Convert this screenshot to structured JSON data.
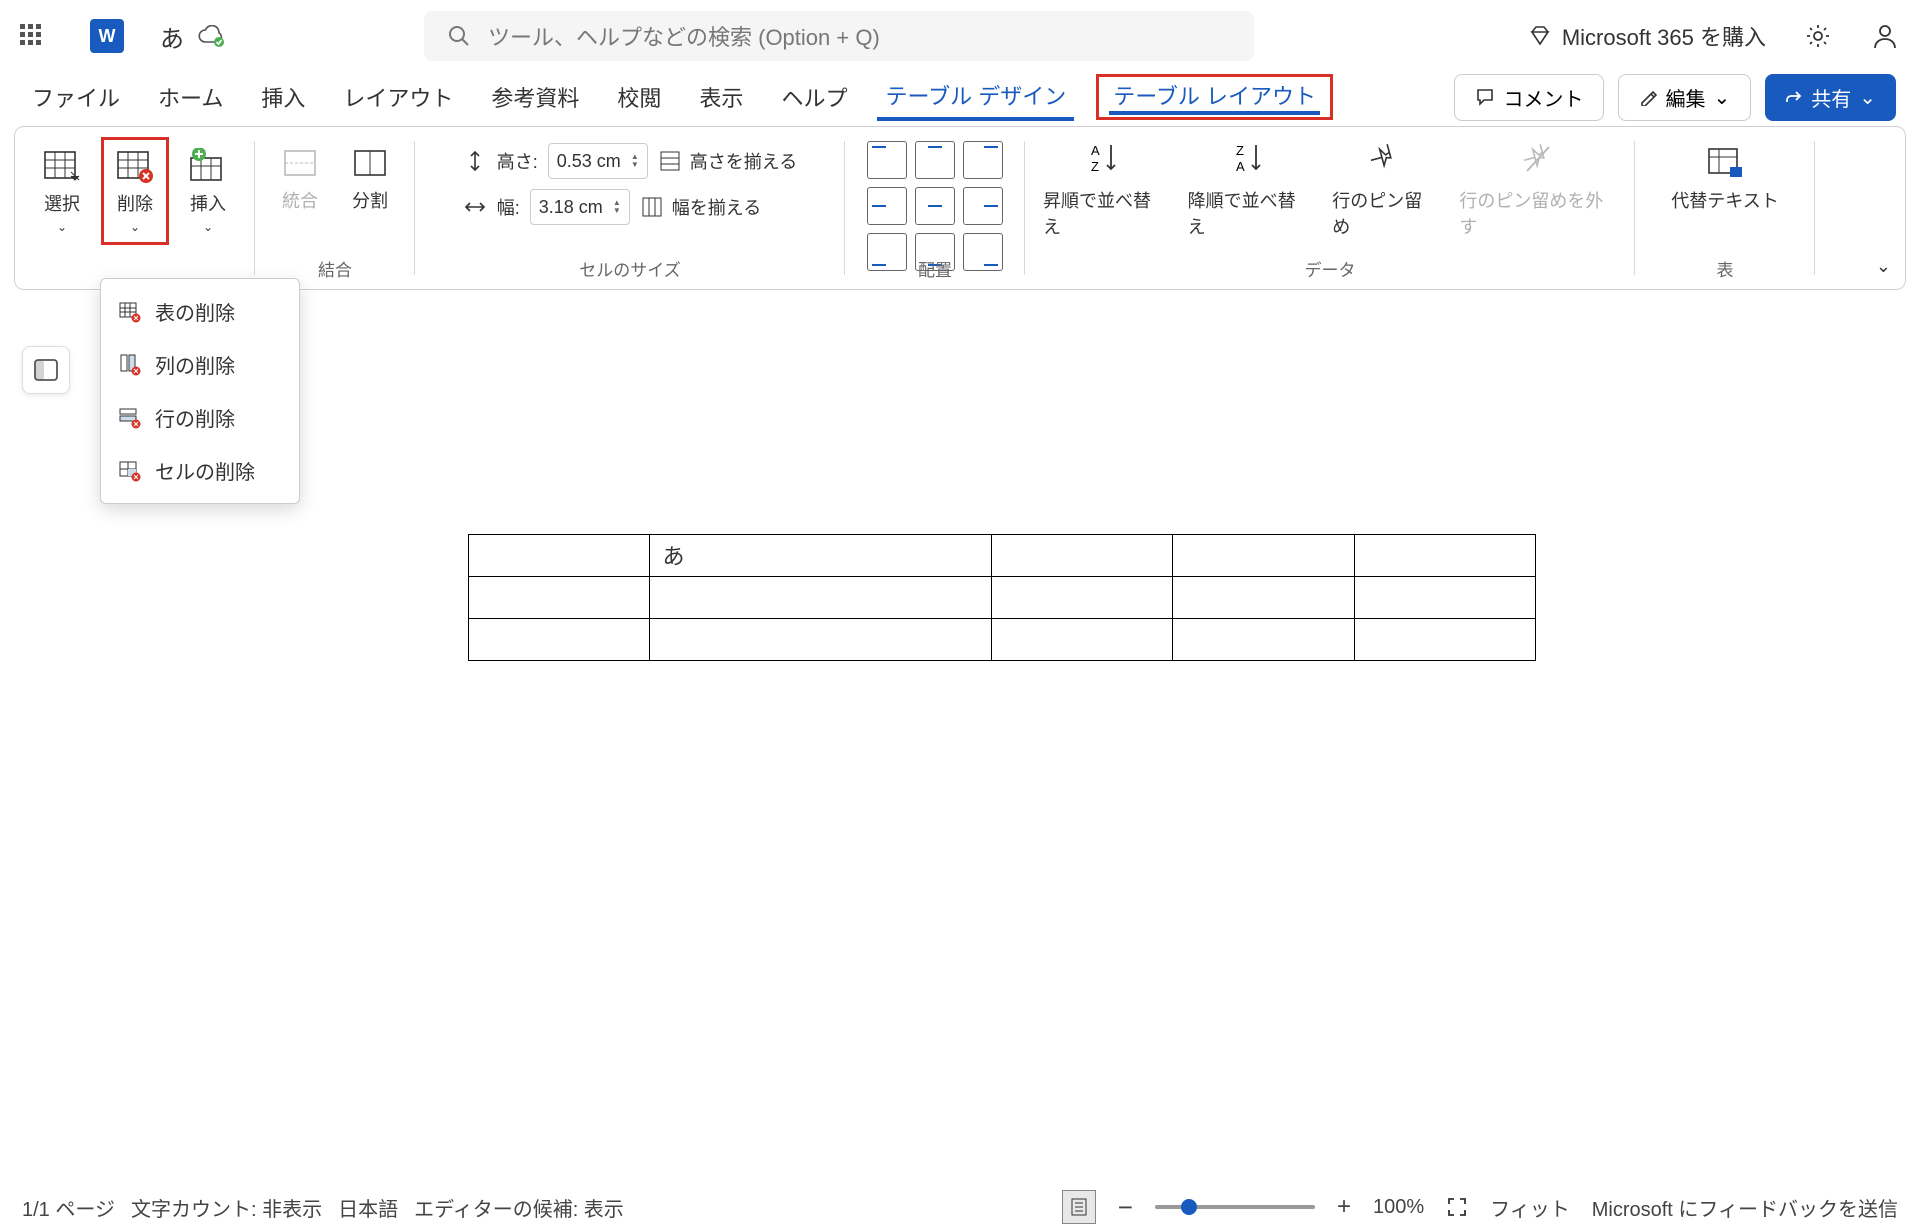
{
  "title": {
    "lang_indicator": "あ",
    "search_placeholder": "ツール、ヘルプなどの検索 (Option + Q)",
    "buy_label": "Microsoft 365 を購入"
  },
  "tabs": {
    "items": [
      "ファイル",
      "ホーム",
      "挿入",
      "レイアウト",
      "参考資料",
      "校閲",
      "表示",
      "ヘルプ",
      "テーブル デザイン",
      "テーブル レイアウト"
    ],
    "active_index": 9,
    "comment_label": "コメント",
    "edit_label": "編集",
    "share_label": "共有"
  },
  "ribbon": {
    "select": {
      "label": "選択"
    },
    "delete": {
      "label": "削除"
    },
    "insert": {
      "label": "挿入"
    },
    "merge": {
      "merge_label": "統合",
      "split_label": "分割",
      "group": "結合"
    },
    "size": {
      "height_label": "高さ:",
      "height_value": "0.53 cm",
      "width_label": "幅:",
      "width_value": "3.18 cm",
      "distribute_rows": "高さを揃える",
      "distribute_cols": "幅を揃える",
      "group": "セルのサイズ"
    },
    "align": {
      "group": "配置"
    },
    "data": {
      "sort_asc": "昇順で並べ替え",
      "sort_desc": "降順で並べ替え",
      "pin_row": "行のピン留め",
      "unpin_row": "行のピン留めを外す",
      "group": "データ"
    },
    "alt": {
      "label": "代替テキスト",
      "group": "表"
    }
  },
  "dropdown": {
    "items": [
      "表の削除",
      "列の削除",
      "行の削除",
      "セルの削除"
    ]
  },
  "document": {
    "cell_content": "あ",
    "rows": 3,
    "cols": 5
  },
  "status": {
    "page": "1/1 ページ",
    "wordcount": "文字カウント: 非表示",
    "lang": "日本語",
    "editor": "エディターの候補: 表示",
    "zoom": "100%",
    "fit": "フィット",
    "feedback": "Microsoft にフィードバックを送信"
  }
}
